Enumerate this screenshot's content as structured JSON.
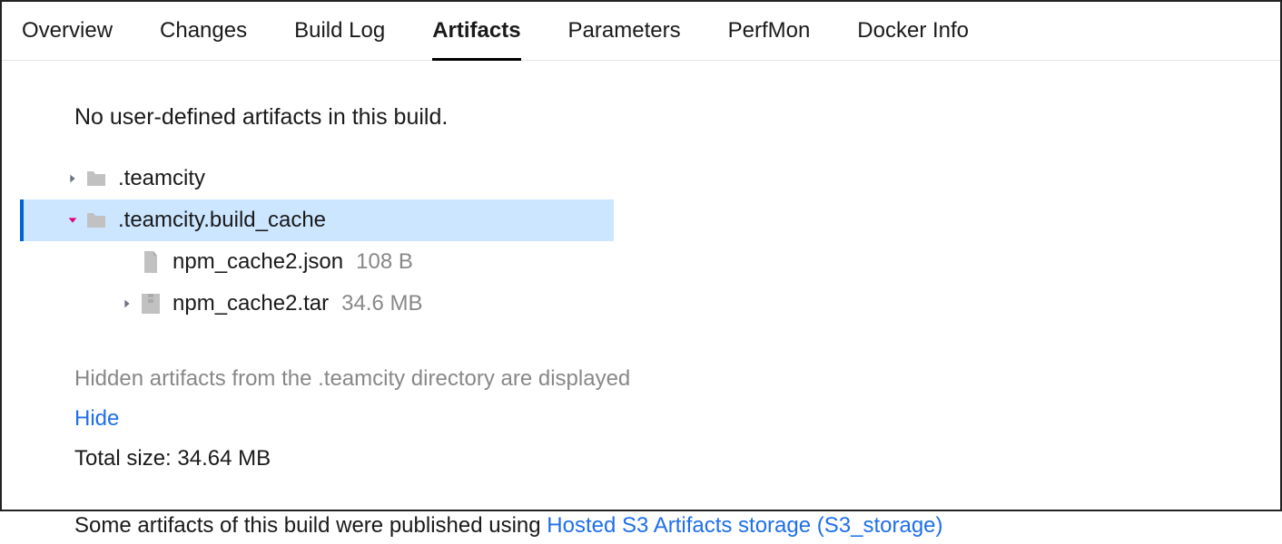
{
  "tabs": [
    {
      "label": "Overview",
      "active": false
    },
    {
      "label": "Changes",
      "active": false
    },
    {
      "label": "Build Log",
      "active": false
    },
    {
      "label": "Artifacts",
      "active": true
    },
    {
      "label": "Parameters",
      "active": false
    },
    {
      "label": "PerfMon",
      "active": false
    },
    {
      "label": "Docker Info",
      "active": false
    }
  ],
  "message": "No user-defined artifacts in this build.",
  "tree": {
    "row0": {
      "label": ".teamcity"
    },
    "row1": {
      "label": ".teamcity.build_cache"
    },
    "row2": {
      "label": "npm_cache2.json",
      "size": "108 B"
    },
    "row3": {
      "label": "npm_cache2.tar",
      "size": "34.6 MB"
    }
  },
  "footer": {
    "hidden_note": "Hidden artifacts from the .teamcity directory are displayed",
    "hide_label": "Hide",
    "total_size": "Total size: 34.64 MB",
    "publish_prefix": "Some artifacts of this build were published using ",
    "storage_link": "Hosted S3 Artifacts storage (S3_storage)"
  }
}
